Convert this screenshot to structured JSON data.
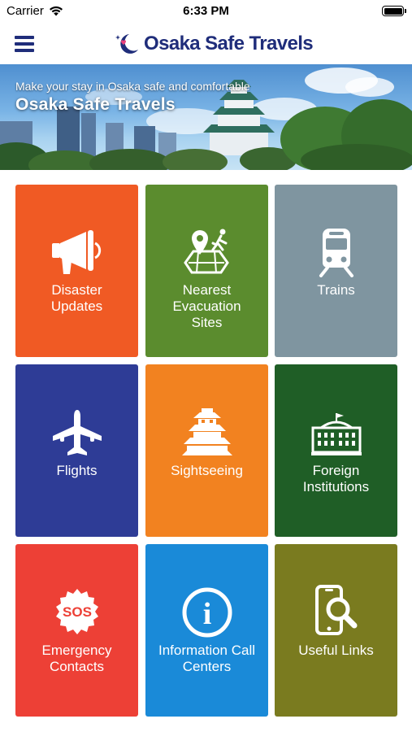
{
  "status_bar": {
    "carrier": "Carrier",
    "time": "6:33 PM",
    "wifi_icon": "wifi-icon",
    "battery_icon": "battery-icon"
  },
  "nav": {
    "menu_icon": "hamburger-menu-icon",
    "logo_text": "Osaka Safe Travels"
  },
  "banner": {
    "tagline": "Make your stay in Osaka safe and comfortable",
    "title": "Osaka Safe Travels"
  },
  "tiles": [
    {
      "label": "Disaster Updates",
      "icon": "megaphone-icon",
      "color": "#f05a24"
    },
    {
      "label": "Nearest Evacuation Sites",
      "icon": "evacuation-map-icon",
      "color": "#5b8c2e"
    },
    {
      "label": "Trains",
      "icon": "train-icon",
      "color": "#7f95a0"
    },
    {
      "label": "Flights",
      "icon": "airplane-icon",
      "color": "#2e3c96"
    },
    {
      "label": "Sightseeing",
      "icon": "castle-icon",
      "color": "#f28220"
    },
    {
      "label": "Foreign Institutions",
      "icon": "building-icon",
      "color": "#1f5e26"
    },
    {
      "label": "Emergency Contacts",
      "icon": "sos-icon",
      "color": "#ed4036"
    },
    {
      "label": "Information Call Centers",
      "icon": "info-icon",
      "color": "#1a8ad8"
    },
    {
      "label": "Useful Links",
      "icon": "phone-search-icon",
      "color": "#7a7b1f"
    }
  ],
  "sos_text": "SOS",
  "info_glyph": "i"
}
